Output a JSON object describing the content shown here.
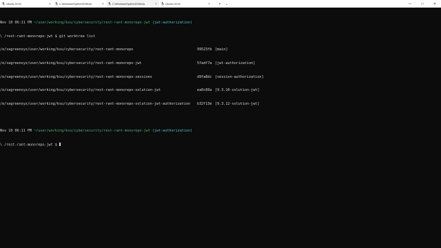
{
  "tabs": [
    {
      "title": "Ubuntu 20.04",
      "icon": "penguin-icon",
      "active": false
    },
    {
      "title": "C:\\Windows\\System32\\Windo",
      "icon": "penguin-icon",
      "active": false
    },
    {
      "title": "C:\\Windows\\System32\\Winds",
      "icon": "penguin-icon",
      "active": true
    },
    {
      "title": "Ubuntu 20.04",
      "icon": "penguin-icon",
      "active": false
    }
  ],
  "tab_close_glyph": "×",
  "tab_actions": {
    "new_tab": "+",
    "dropdown": "⌄"
  },
  "window_controls": {
    "minimize": "—",
    "maximize": "□",
    "close": "✕"
  },
  "terminal": {
    "prompt1": {
      "time": "Nov 10 06:11 PM",
      "path": "~/user/working/ksu/cybersecurity/rest-rant-monorepo-jwt",
      "branch": "(jwt-authorization)",
      "shell": "\\ /rest-rant-monorepo-jwt $",
      "command": "git worktree list"
    },
    "worktrees": [
      {
        "path": "/e/sagreenxyz/user/working/ksu/cybersecurity/rest-rant-monorepo",
        "hash": "99523fb",
        "branch": "[main]"
      },
      {
        "path": "/e/sagreenxyz/user/working/ksu/cybersecurity/rest-rant-monorepo-jwt",
        "hash": "5fadf7a",
        "branch": "[jwt-authorization]"
      },
      {
        "path": "/e/sagreenxyz/user/working/ksu/cybersecurity/rest-rant-monorepo-sessions",
        "hash": "d9fa8dc",
        "branch": "[session-authorization]"
      },
      {
        "path": "/e/sagreenxyz/user/working/ksu/cybersecurity/rest-rant-monorepo-solution-jwt",
        "hash": "ea0c89a",
        "branch": "[9.3.10-solution-jwt]"
      },
      {
        "path": "/e/sagreenxyz/user/working/ksu/cybersecurity/rest-rant-monorepo-solution-jwt-authorization",
        "hash": "b32f13e",
        "branch": "[9.3.12-solution-jwt]"
      }
    ],
    "prompt2": {
      "time": "Nov 10 06:11 PM",
      "path": "~/user/working/ksu/cybersecurity/rest-rant-monorepo-jwt",
      "branch": "(jwt-authorization)",
      "shell": "\\ /rest-rant-monorepo-jwt $"
    }
  }
}
